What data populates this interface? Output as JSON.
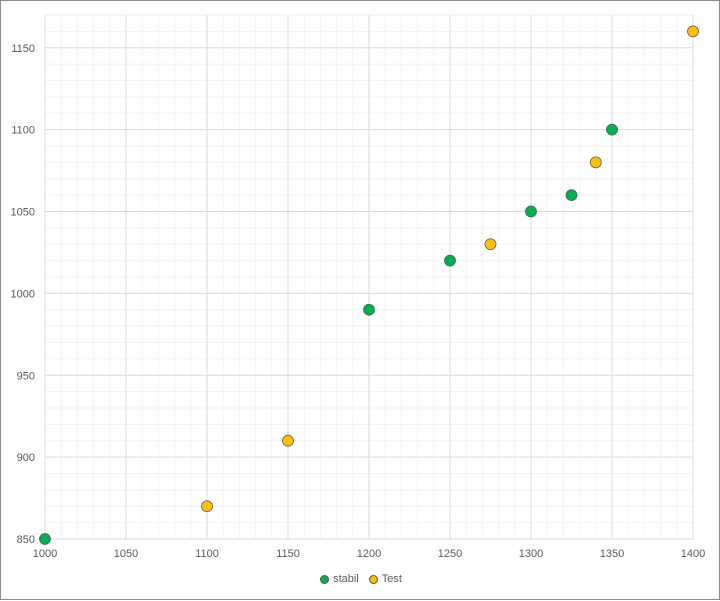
{
  "chart_data": {
    "type": "scatter",
    "title": "",
    "xlabel": "",
    "ylabel": "",
    "xlim": [
      1000,
      1400
    ],
    "ylim": [
      850,
      1170
    ],
    "xticks": [
      1000,
      1050,
      1100,
      1150,
      1200,
      1250,
      1300,
      1350,
      1400
    ],
    "yticks": [
      850,
      900,
      950,
      1000,
      1050,
      1100,
      1150
    ],
    "grid": true,
    "legend_position": "bottom",
    "series": [
      {
        "name": "stabil",
        "color": "#00b050",
        "points": [
          [
            1000,
            850
          ],
          [
            1200,
            990
          ],
          [
            1250,
            1020
          ],
          [
            1300,
            1050
          ],
          [
            1325,
            1060
          ],
          [
            1350,
            1100
          ]
        ]
      },
      {
        "name": "Test",
        "color": "#ffc000",
        "points": [
          [
            1100,
            870
          ],
          [
            1150,
            910
          ],
          [
            1275,
            1030
          ],
          [
            1340,
            1080
          ],
          [
            1400,
            1160
          ]
        ]
      }
    ]
  }
}
